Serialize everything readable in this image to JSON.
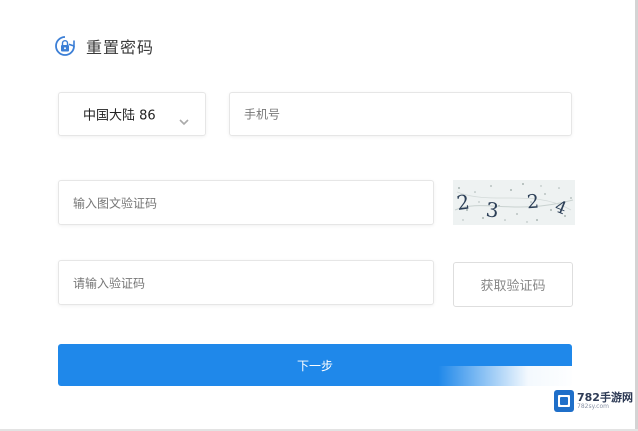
{
  "header": {
    "title": "重置密码",
    "icon": "lock-refresh-icon",
    "icon_color": "#1f88ea"
  },
  "form": {
    "country": {
      "value": "中国大陆 86",
      "icon": "chevron-down-icon"
    },
    "phone": {
      "placeholder": "手机号"
    },
    "captcha": {
      "placeholder": "输入图文验证码",
      "image_text": "2 3 2 4"
    },
    "sms_code": {
      "placeholder": "请输入验证码"
    },
    "get_code_label": "获取验证码",
    "next_label": "下一步"
  },
  "watermark": {
    "name": "782手游网",
    "url": "782sy.com"
  },
  "colors": {
    "primary": "#1f88ea",
    "border": "#e6e6e6",
    "placeholder": "#777777"
  }
}
